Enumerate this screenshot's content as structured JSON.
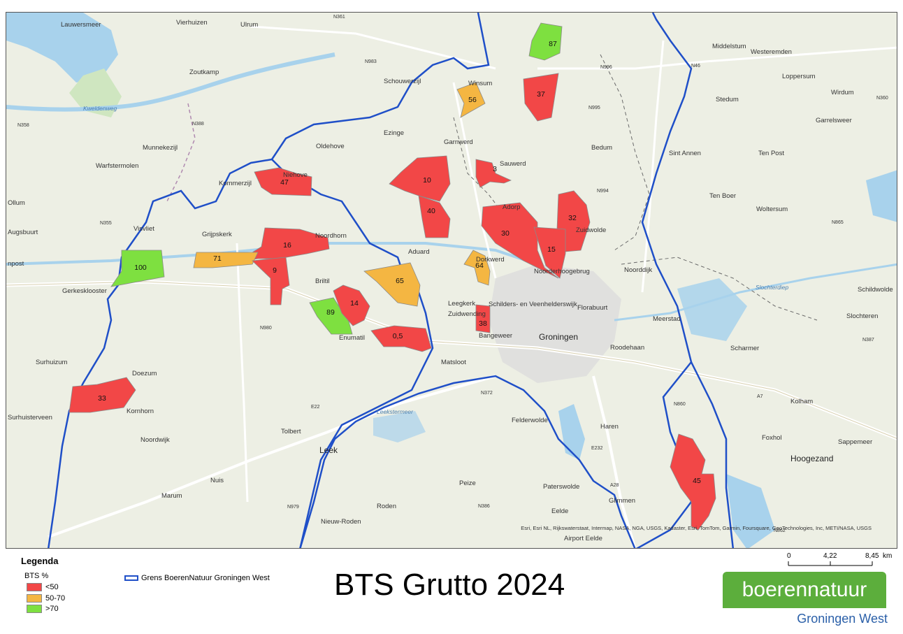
{
  "title": "BTS Grutto 2024",
  "legend": {
    "title": "Legenda",
    "subtitle": "BTS %",
    "classes": [
      {
        "label": "<50",
        "color": "#f24747"
      },
      {
        "label": "50-70",
        "color": "#f4b642"
      },
      {
        "label": ">70",
        "color": "#7ee040"
      }
    ],
    "boundary_label": "Grens BoerenNatuur Groningen West",
    "boundary_color": "#1f4fc8"
  },
  "scalebar": {
    "ticks": [
      "0",
      "4,22",
      "8,45"
    ],
    "unit": "km"
  },
  "logo": {
    "part1": "boeren",
    "part2": "natuur",
    "subtitle": "Groningen West"
  },
  "attribution": "Esri, Esri NL, Rijkswaterstaat, Intermap, NASA, NGA, USGS, Kadaster, Esri, TomTom, Garmin, Foursquare, GeoTechnologies, Inc, METI/NASA, USGS",
  "parcels": [
    {
      "label": "87",
      "value": 87,
      "class": ">70"
    },
    {
      "label": "56",
      "value": 56,
      "class": "50-70"
    },
    {
      "label": "37",
      "value": 37,
      "class": "<50"
    },
    {
      "label": "47",
      "value": 47,
      "class": "<50"
    },
    {
      "label": "10",
      "value": 10,
      "class": "<50"
    },
    {
      "label": "3",
      "value": 3,
      "class": "<50"
    },
    {
      "label": "40",
      "value": 40,
      "class": "<50"
    },
    {
      "label": "32",
      "value": 32,
      "class": "<50"
    },
    {
      "label": "30",
      "value": 30,
      "class": "<50"
    },
    {
      "label": "15",
      "value": 15,
      "class": "<50"
    },
    {
      "label": "16",
      "value": 16,
      "class": "<50"
    },
    {
      "label": "71",
      "value": 71,
      "class": "50-70"
    },
    {
      "label": "100",
      "value": 100,
      "class": ">70"
    },
    {
      "label": "9",
      "value": 9,
      "class": "<50"
    },
    {
      "label": "64",
      "value": 64,
      "class": "50-70"
    },
    {
      "label": "65",
      "value": 65,
      "class": "50-70"
    },
    {
      "label": "89",
      "value": 89,
      "class": ">70"
    },
    {
      "label": "14",
      "value": 14,
      "class": "<50"
    },
    {
      "label": "38",
      "value": 38,
      "class": "<50"
    },
    {
      "label": "0,5",
      "value": 0.5,
      "class": "<50"
    },
    {
      "label": "33",
      "value": 33,
      "class": "<50"
    },
    {
      "label": "45",
      "value": 45,
      "class": "<50"
    }
  ],
  "places": [
    "Lauwersmeer",
    "Vierhuizen",
    "Ulrum",
    "Zoutkamp",
    "Schouwerzijl",
    "Winsum",
    "Middelstum",
    "Westeremden",
    "Loppersum",
    "Stedum",
    "Wirdum",
    "Garrelsweer",
    "Ezinge",
    "Garnwerd",
    "Oldehove",
    "Sauwerd",
    "Bedum",
    "Sint Annen",
    "Ten Post",
    "Munnekezijl",
    "Warfstermolen",
    "Niehove",
    "Kommerzijl",
    "Ten Boer",
    "Woltersum",
    "Adorp",
    "Zuidwolde",
    "Visvliet",
    "Grijpskerk",
    "Noordhorn",
    "Augsbuurt",
    "Aduard",
    "Dorkwerd",
    "Noorderhoogebrug",
    "Noorddijk",
    "Gerkesklooster",
    "Briltil",
    "Leegkerk",
    "Schilders- en Veenhelderswijk",
    "Florabuurt",
    "Schildwolde",
    "Zuidwending",
    "Enumatil",
    "Meerstad",
    "Slochteren",
    "Groningen",
    "Scharmer",
    "Surhuizum",
    "Matsloot",
    "Bangeweer",
    "Roodehaan",
    "Doezum",
    "Kolham",
    "Surhuisterveen",
    "Kornhorn",
    "Tolbert",
    "Felderwolde",
    "Haren",
    "Foxhol",
    "Sappemeer",
    "Noordwijk",
    "Leek",
    "Hoogezand",
    "Nuis",
    "Peize",
    "Paterswolde",
    "Marum",
    "Glimmen",
    "Roden",
    "Eelde",
    "Nieuw-Roden",
    "Airport Eelde",
    "Ollum",
    "npost",
    "Kweldenweg",
    "Slochterdiep",
    "Leekstermeer"
  ],
  "roads": [
    "N361",
    "N983",
    "N996",
    "N995",
    "N46",
    "N360",
    "N358",
    "N388",
    "N355",
    "N994",
    "N865",
    "N387",
    "N980",
    "N862",
    "N860",
    "E22",
    "A7",
    "N372",
    "A28",
    "N386",
    "E232",
    "N979"
  ]
}
